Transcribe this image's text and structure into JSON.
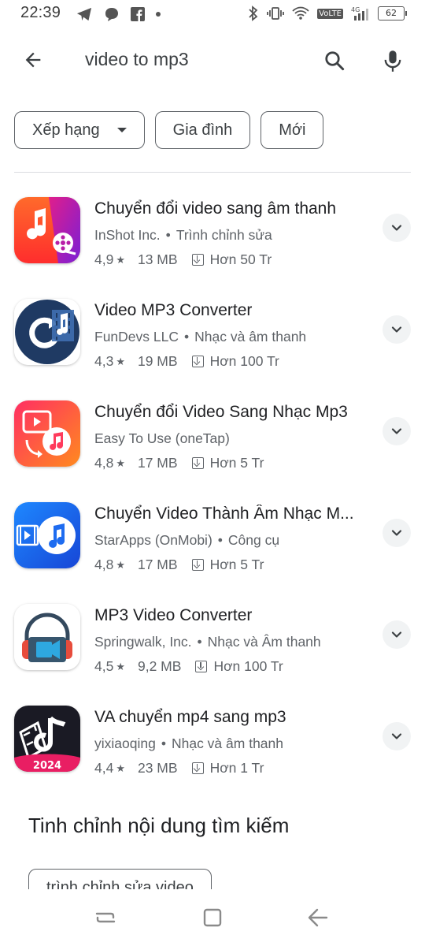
{
  "status_bar": {
    "time": "22:39",
    "network_label": "VoLTE",
    "network_gen": "4G",
    "battery": "62"
  },
  "search": {
    "query": "video to mp3"
  },
  "filters": [
    {
      "label": "Xếp hạng",
      "has_dropdown": true
    },
    {
      "label": "Gia đình",
      "has_dropdown": false
    },
    {
      "label": "Mới",
      "has_dropdown": false
    }
  ],
  "apps": [
    {
      "title": "Chuyển đổi video sang âm thanh",
      "developer": "InShot Inc.",
      "category": "Trình chỉnh sửa",
      "rating": "4,9",
      "size": "13 MB",
      "downloads": "Hơn 50 Tr",
      "icon": "inshot-audio-icon"
    },
    {
      "title": "Video MP3 Converter",
      "developer": "FunDevs LLC",
      "category": "Nhạc và âm thanh",
      "rating": "4,3",
      "size": "19 MB",
      "downloads": "Hơn 100 Tr",
      "icon": "fundevs-converter-icon"
    },
    {
      "title": "Chuyển đổi Video Sang Nhạc Mp3",
      "developer": "Easy To Use (oneTap)",
      "category": "",
      "rating": "4,8",
      "size": "17 MB",
      "downloads": "Hơn 5 Tr",
      "icon": "onetap-converter-icon"
    },
    {
      "title": "Chuyển Video Thành Âm Nhạc M...",
      "developer": "StarApps (OnMobi)",
      "category": "Công cụ",
      "rating": "4,8",
      "size": "17 MB",
      "downloads": "Hơn 5 Tr",
      "icon": "starapps-converter-icon"
    },
    {
      "title": "MP3 Video Converter",
      "developer": "Springwalk, Inc.",
      "category": "Nhạc và Âm thanh",
      "rating": "4,5",
      "size": "9,2 MB",
      "downloads": "Hơn 100 Tr",
      "icon": "springwalk-headphones-icon"
    },
    {
      "title": "VA chuyển mp4 sang mp3",
      "developer": "yixiaoqing",
      "category": "Nhạc và âm thanh",
      "rating": "4,4",
      "size": "23 MB",
      "downloads": "Hơn 1 Tr",
      "icon": "va-converter-icon",
      "icon_badge": "2024"
    }
  ],
  "refine": {
    "title": "Tinh chỉnh nội dung tìm kiếm",
    "chip": "trình chỉnh sửa video"
  },
  "colors": {
    "accent_text": "#202124",
    "secondary_text": "#5f6368",
    "chip_border": "#5f6368"
  }
}
